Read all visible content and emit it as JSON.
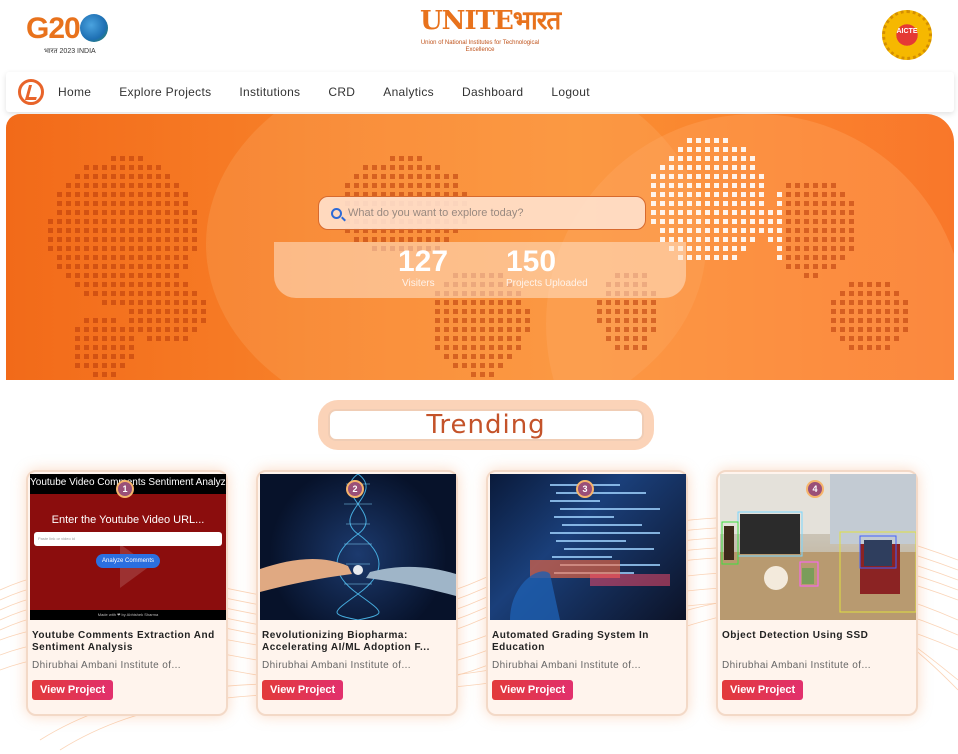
{
  "header": {
    "g20_logo_text": "G20",
    "g20_logo_sub": "भारत 2023 INDIA",
    "unite_logo_word": "UNITE",
    "unite_logo_hindi": "भारत",
    "unite_logo_sub": "Union of National Institutes for Technological Excellence",
    "aicte_logo_text": "AICTE"
  },
  "nav": {
    "items": [
      "Home",
      "Explore Projects",
      "Institutions",
      "CRD",
      "Analytics",
      "Dashboard",
      "Logout"
    ]
  },
  "hero": {
    "search_placeholder": "What do you want to explore today?",
    "stats": [
      {
        "value": "127",
        "label": "Visiters"
      },
      {
        "value": "150",
        "label": "Projects Uploaded"
      }
    ]
  },
  "trending": {
    "heading": "Trending"
  },
  "cards": [
    {
      "rank": "1",
      "title": "Youtube Comments Extraction And Sentiment Analysis",
      "institution": "Dhirubhai Ambani Institute of...",
      "button": "View Project",
      "thumb_title": "Youtube Video Comments Sentiment Analyzer",
      "thumb_prompt": "Enter the Youtube Video URL...",
      "thumb_input": "Paste link or video id",
      "thumb_button": "Analyze Comments",
      "thumb_footer": "Made with ❤ by Abhishek Sharma"
    },
    {
      "rank": "2",
      "title": "Revolutionizing Biopharma: Accelerating AI/ML Adoption F...",
      "institution": "Dhirubhai Ambani Institute of...",
      "button": "View Project"
    },
    {
      "rank": "3",
      "title": "Automated Grading System In Education",
      "institution": "Dhirubhai Ambani Institute of...",
      "button": "View Project"
    },
    {
      "rank": "4",
      "title": "Object Detection Using SSD",
      "institution": "Dhirubhai Ambani Institute of...",
      "button": "View Project"
    }
  ],
  "colors": {
    "brand_orange": "#f26a19",
    "button_red": "#e23a3a",
    "trending_text": "#c4532a"
  }
}
